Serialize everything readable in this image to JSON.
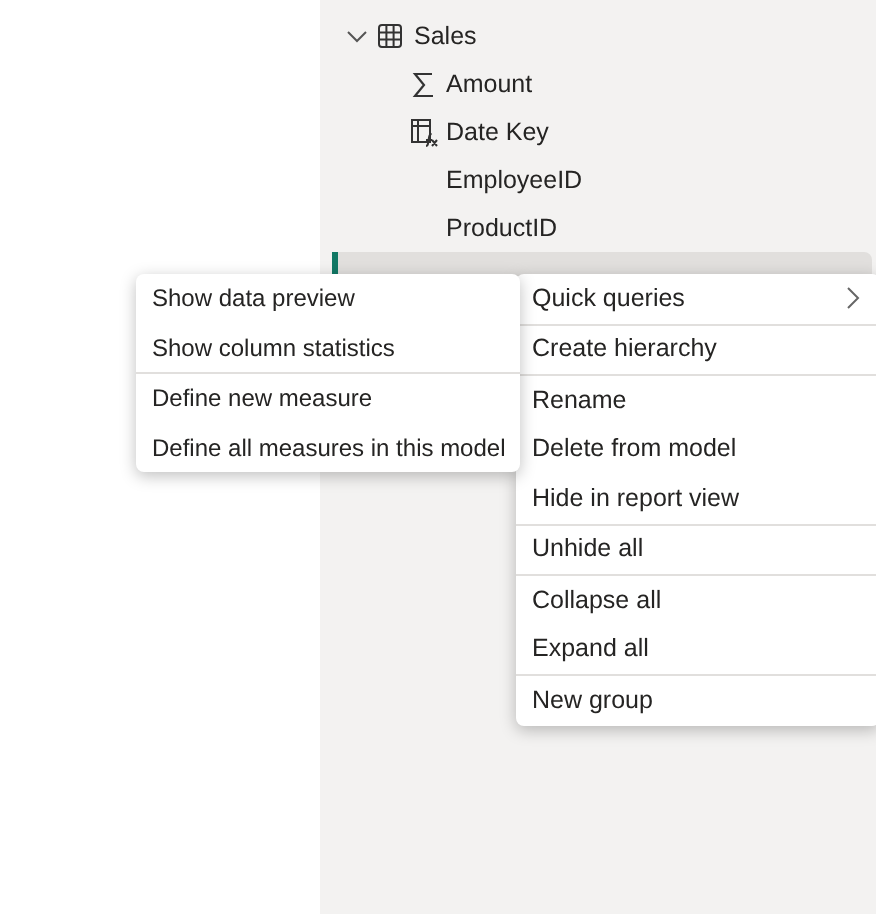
{
  "tree": {
    "table": {
      "label": "Sales",
      "expanded": true
    },
    "fields": [
      {
        "label": "Amount",
        "kind": "measure"
      },
      {
        "label": "Date Key",
        "kind": "calculated"
      },
      {
        "label": "EmployeeID",
        "kind": "plain"
      },
      {
        "label": "ProductID",
        "kind": "plain"
      }
    ],
    "selected_row": {
      "selected": true
    }
  },
  "context_menu": {
    "groups": [
      [
        {
          "label": "Quick queries",
          "submenu": true
        }
      ],
      [
        {
          "label": "Create hierarchy",
          "submenu": false
        }
      ],
      [
        {
          "label": "Rename",
          "submenu": false
        },
        {
          "label": "Delete from model",
          "submenu": false
        },
        {
          "label": "Hide in report view",
          "submenu": false
        }
      ],
      [
        {
          "label": "Unhide all",
          "submenu": false
        }
      ],
      [
        {
          "label": "Collapse all",
          "submenu": false
        },
        {
          "label": "Expand all",
          "submenu": false
        }
      ],
      [
        {
          "label": "New group",
          "submenu": false
        }
      ]
    ]
  },
  "submenu": {
    "groups": [
      [
        "Show data preview",
        "Show column statistics"
      ],
      [
        "Define new measure",
        "Define all measures in this model"
      ]
    ]
  }
}
